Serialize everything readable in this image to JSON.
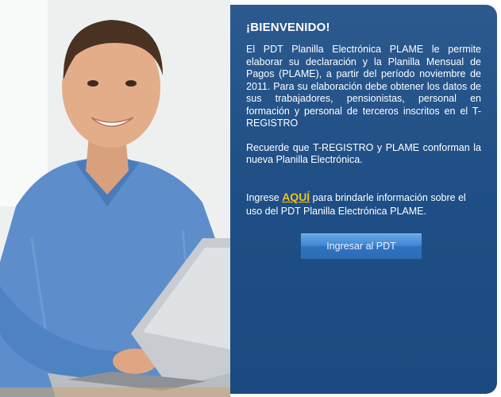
{
  "welcome": {
    "title": "¡BIENVENIDO!",
    "paragraph1": "El PDT Planilla Electrónica PLAME le permite elaborar su declaración y la Planilla Mensual de Pagos (PLAME), a partir del período noviembre de 2011. Para su elaboración debe obtener los datos de sus trabajadores, pensionistas, personal en formación y personal de terceros inscritos en el T-REGISTRO",
    "paragraph2": "Recuerde que T-REGISTRO y PLAME conforman la nueva Planilla Electrónica.",
    "info_prefix": "Ingrese",
    "info_link": "AQUÍ",
    "info_suffix": "para brindarle información sobre  el uso del PDT Planilla Electrónica PLAME.",
    "button_label": "Ingresar al PDT"
  },
  "colors": {
    "panel_blue": "#1f4f86",
    "link_yellow": "#f3c21b",
    "button_blue": "#3f86d3"
  }
}
